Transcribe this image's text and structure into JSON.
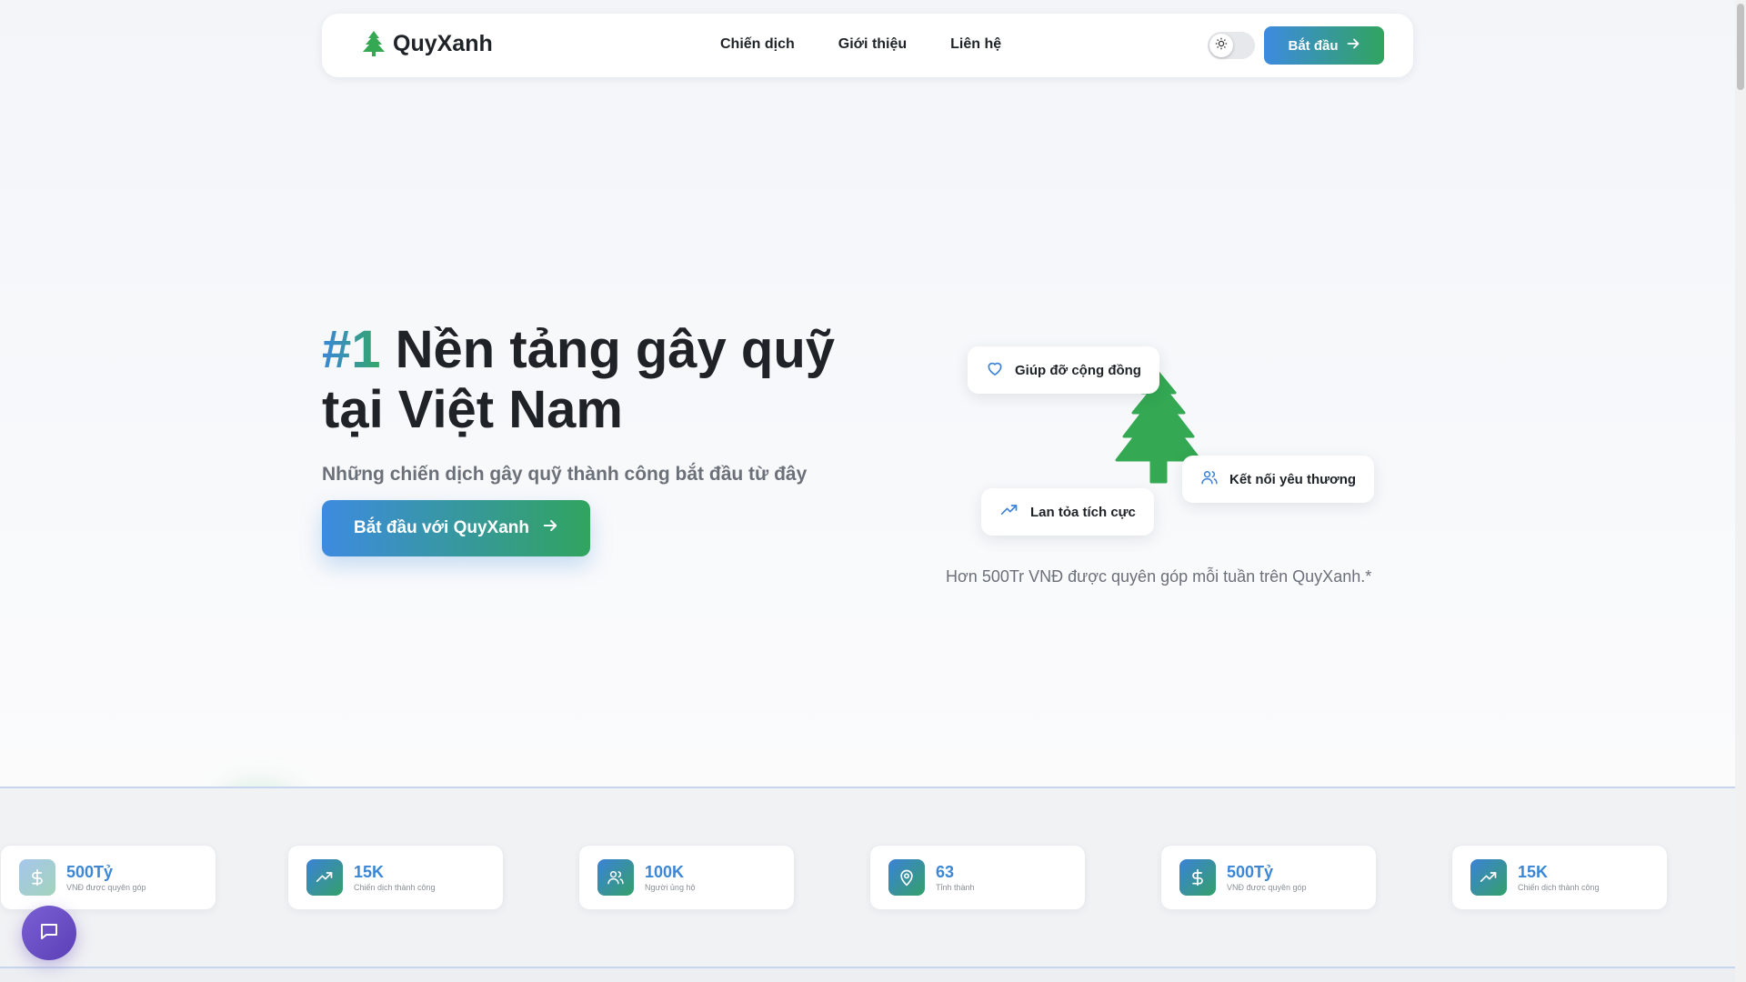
{
  "brand": {
    "name": "QuyXanh",
    "icon": "tree-icon"
  },
  "nav": {
    "links": [
      "Chiến dịch",
      "Giới thiệu",
      "Liên hệ"
    ],
    "cta_label": "Bắt đầu"
  },
  "hero": {
    "title_accent": "#1",
    "title_rest": " Nền tảng gây quỹ tại Việt Nam",
    "subtitle": "Những chiến dịch gây quỹ thành công bắt đầu từ đây",
    "cta_label": "Bắt đầu với QuyXanh",
    "note": "Hơn 500Tr VNĐ được quyên góp mỗi tuần trên QuyXanh.*"
  },
  "floating_cards": [
    {
      "label": "Giúp đỡ cộng đồng",
      "icon": "heart-icon"
    },
    {
      "label": "Kết nối yêu thương",
      "icon": "users-icon"
    },
    {
      "label": "Lan tỏa tích cực",
      "icon": "trending-up-icon"
    }
  ],
  "stats": [
    {
      "value": "500Tỷ",
      "label": "VNĐ được quyên góp",
      "icon": "dollar-icon"
    },
    {
      "value": "15K",
      "label": "Chiến dịch thành công",
      "icon": "trending-up-icon"
    },
    {
      "value": "100K",
      "label": "Người ủng hộ",
      "icon": "users-icon"
    },
    {
      "value": "63",
      "label": "Tỉnh thành",
      "icon": "map-pin-icon"
    },
    {
      "value": "500Tỷ",
      "label": "VNĐ được quyên góp",
      "icon": "dollar-icon"
    },
    {
      "value": "15K",
      "label": "Chiến dịch thành công",
      "icon": "trending-up-icon"
    }
  ],
  "colors": {
    "brand_green": "#34a853",
    "accent_blue": "#3b87d6",
    "chat_purple": "#6a4dc4"
  },
  "chat": {
    "icon": "chat-icon"
  },
  "theme_toggle": {
    "icon": "sun-icon"
  }
}
